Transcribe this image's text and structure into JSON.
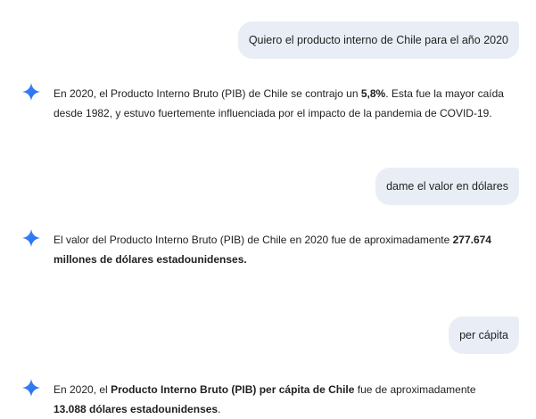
{
  "conversation": {
    "turns": [
      {
        "role": "user",
        "text": "Quiero el producto interno de Chile para el año 2020"
      },
      {
        "role": "assistant",
        "icon": "gemini-spark-icon",
        "parts": [
          {
            "text": "En 2020, el Producto Interno Bruto (PIB) de Chile se contrajo un ",
            "bold": false
          },
          {
            "text": "5,8%",
            "bold": true
          },
          {
            "text": ". Esta fue la mayor caída desde 1982, y estuvo fuertemente influenciada por el impacto de la pandemia de COVID-19.",
            "bold": false
          }
        ]
      },
      {
        "role": "user",
        "text": "dame el valor en dólares"
      },
      {
        "role": "assistant",
        "icon": "gemini-spark-icon",
        "parts": [
          {
            "text": "El valor del Producto Interno Bruto (PIB) de Chile en 2020 fue de aproximadamente ",
            "bold": false
          },
          {
            "text": "277.674 millones de dólares estadounidenses.",
            "bold": true
          }
        ]
      },
      {
        "role": "user",
        "text": "per cápita"
      },
      {
        "role": "assistant",
        "icon": "gemini-spark-icon",
        "parts": [
          {
            "text": "En 2020, el ",
            "bold": false
          },
          {
            "text": "Producto Interno Bruto (PIB) per cápita de Chile",
            "bold": true
          },
          {
            "text": " fue de aproximadamente ",
            "bold": false
          },
          {
            "text": "13.088 dólares estadounidenses",
            "bold": true
          },
          {
            "text": ".",
            "bold": false
          }
        ]
      }
    ]
  },
  "colors": {
    "user_bubble_bg": "#e9eef6",
    "spark_gradient_start": "#4285f4",
    "spark_gradient_end": "#1b6ef3",
    "text": "#1f1f1f"
  }
}
